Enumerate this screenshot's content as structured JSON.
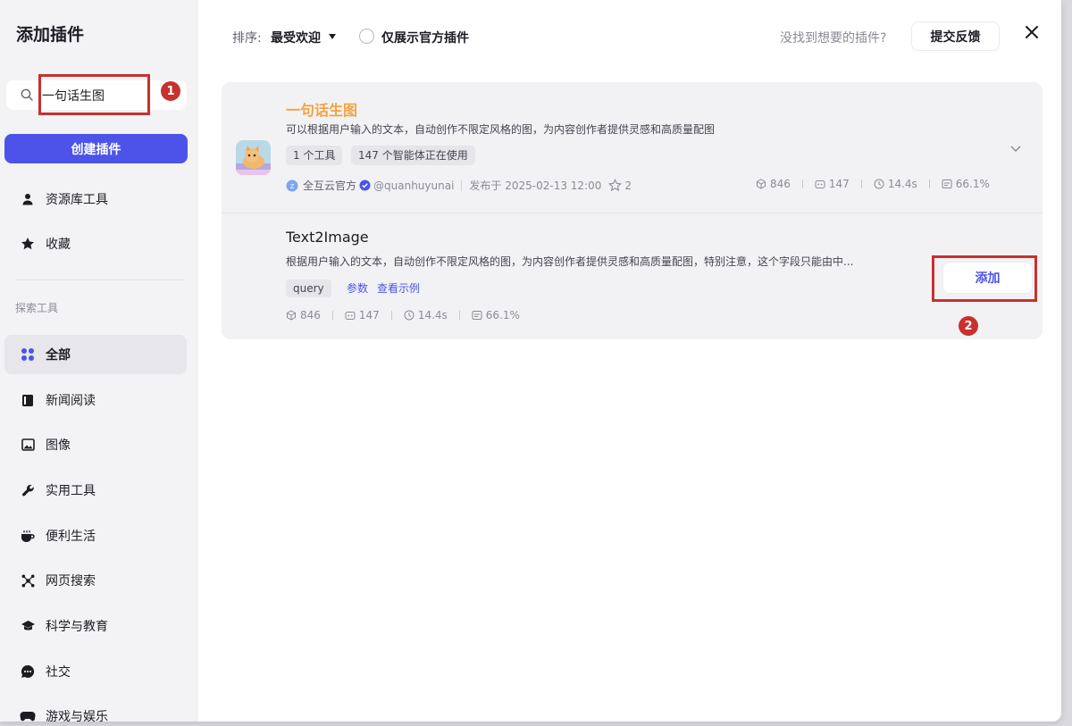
{
  "sidebar": {
    "title": "添加插件",
    "search_value": "一句话生图",
    "create_label": "创建插件",
    "items_top": [
      {
        "label": "资源库工具",
        "icon": "person-icon"
      },
      {
        "label": "收藏",
        "icon": "star-icon"
      }
    ],
    "section_label": "探索工具",
    "categories": [
      {
        "label": "全部",
        "icon": "grid-icon",
        "active": true
      },
      {
        "label": "新闻阅读",
        "icon": "book-icon"
      },
      {
        "label": "图像",
        "icon": "image-icon"
      },
      {
        "label": "实用工具",
        "icon": "wrench-icon"
      },
      {
        "label": "便利生活",
        "icon": "cup-icon"
      },
      {
        "label": "网页搜索",
        "icon": "network-icon"
      },
      {
        "label": "科学与教育",
        "icon": "graduation-cap-icon"
      },
      {
        "label": "社交",
        "icon": "chat-icon"
      },
      {
        "label": "游戏与娱乐",
        "icon": "gamepad-icon"
      }
    ]
  },
  "toolbar": {
    "sort_label": "排序:",
    "sort_value": "最受欢迎",
    "official_only_label": "仅展示官方插件",
    "hint": "没找到想要的插件?",
    "feedback_label": "提交反馈"
  },
  "plugin": {
    "name": "一句话生图",
    "description": "可以根据用户输入的文本，自动创作不限定风格的图，为内容创作者提供灵感和高质量配图",
    "tags": [
      "1 个工具",
      "147 个智能体正在使用"
    ],
    "author": "全互云官方",
    "handle": "@quanhuyunai",
    "published": "发布于 2025-02-13 12:00",
    "stars": "2",
    "stats": {
      "calls": "846",
      "bots": "147",
      "latency": "14.4s",
      "success": "66.1%"
    }
  },
  "tool": {
    "name": "Text2Image",
    "description": "根据用户输入的文本，自动创作不限定风格的图，为内容创作者提供灵感和高质量配图，特别注意，这个字段只能由中...",
    "param": "query",
    "params_link": "参数",
    "example_link": "查看示例",
    "stats": {
      "calls": "846",
      "bots": "147",
      "latency": "14.4s",
      "success": "66.1%"
    },
    "add_label": "添加"
  },
  "annotations": {
    "badge1": "1",
    "badge2": "2"
  },
  "colors": {
    "accent": "#4d53e8",
    "plugin_name": "#f4a340",
    "annotation": "#c8312c"
  }
}
